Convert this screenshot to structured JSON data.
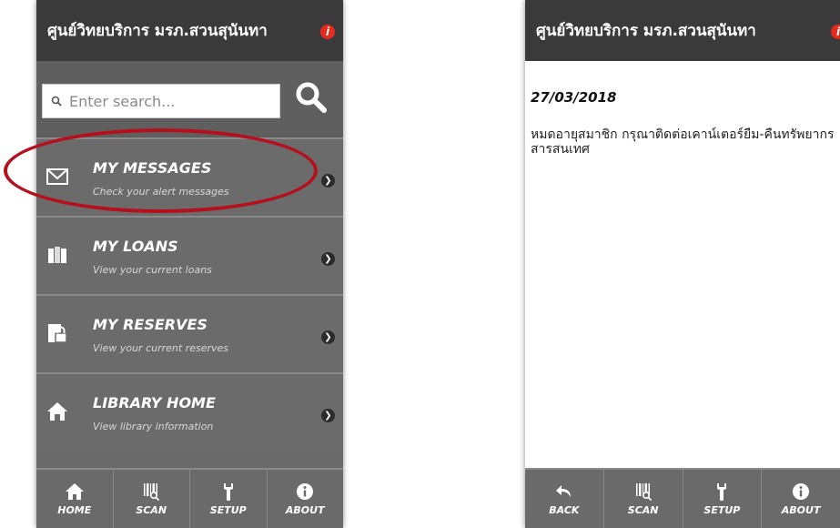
{
  "app_title": "ศูนย์วิทยบริการ มรภ.สวนสุนันทา",
  "search": {
    "placeholder": "Enter search..."
  },
  "menu": [
    {
      "title": "MY MESSAGES",
      "subtitle": "Check your alert messages",
      "icon": "envelope-icon"
    },
    {
      "title": "MY LOANS",
      "subtitle": "View your current loans",
      "icon": "books-icon"
    },
    {
      "title": "MY RESERVES",
      "subtitle": "View your current reserves",
      "icon": "lock-book-icon"
    },
    {
      "title": "LIBRARY HOME",
      "subtitle": "View library information",
      "icon": "home-icon"
    }
  ],
  "tabs_left": [
    {
      "label": "HOME",
      "icon": "home-icon"
    },
    {
      "label": "SCAN",
      "icon": "barcode-scan-icon"
    },
    {
      "label": "SETUP",
      "icon": "wrench-icon"
    },
    {
      "label": "ABOUT",
      "icon": "info-icon"
    }
  ],
  "message": {
    "date": "27/03/2018",
    "text": "หมดอายุสมาชิก กรุณาติดต่อเคาน์เตอร์ยืม-คืนทรัพยากรสารสนเทศ"
  },
  "tabs_right": [
    {
      "label": "BACK",
      "icon": "back-arrow-icon"
    },
    {
      "label": "SCAN",
      "icon": "barcode-scan-icon"
    },
    {
      "label": "SETUP",
      "icon": "wrench-icon"
    },
    {
      "label": "ABOUT",
      "icon": "info-icon"
    }
  ],
  "colors": {
    "title_bar": "#3a3a3a",
    "menu_bg": "#6b6b6b",
    "info_badge": "#e8291c",
    "highlight": "#b5101c"
  }
}
